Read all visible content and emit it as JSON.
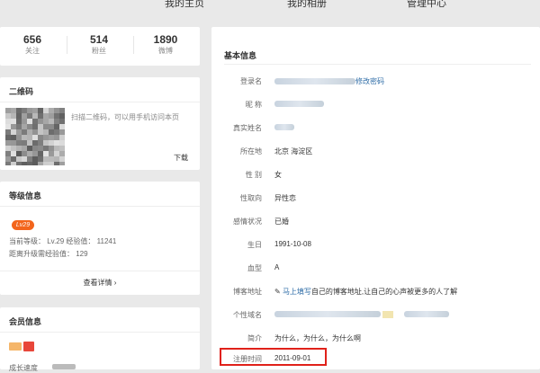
{
  "nav": {
    "tabs": [
      "我的主页",
      "我的相册",
      "管理中心"
    ]
  },
  "stats": [
    {
      "value": "656",
      "label": "关注"
    },
    {
      "value": "514",
      "label": "粉丝"
    },
    {
      "value": "1890",
      "label": "微博"
    }
  ],
  "qr": {
    "title": "二维码",
    "text": "扫描二维码，可以用手机访问本页",
    "download": "下载"
  },
  "level": {
    "title": "等级信息",
    "badge": "Lv29",
    "current": "当前等级：  Lv.29    经验值：  11241",
    "next": "距离升级需经验值：  129",
    "detail": "查看详情 ›"
  },
  "member": {
    "title": "会员信息",
    "streak": "成长速度"
  },
  "basic": {
    "title": "基本信息",
    "change_password": "修改密码",
    "rows": [
      {
        "label": "登录名",
        "value": ""
      },
      {
        "label": "昵 称",
        "value": ""
      },
      {
        "label": "真实姓名",
        "value": ""
      },
      {
        "label": "所在地",
        "value": "北京 海淀区"
      },
      {
        "label": "性 别",
        "value": "女"
      },
      {
        "label": "性取向",
        "value": "异性恋"
      },
      {
        "label": "感情状况",
        "value": "已婚"
      },
      {
        "label": "生日",
        "value": "1991-10-08"
      },
      {
        "label": "血型",
        "value": "A"
      },
      {
        "label": "博客地址",
        "value": "自己的博客地址,让自己的心声被更多的人了解",
        "link": "马上填写"
      },
      {
        "label": "个性域名",
        "value": ""
      },
      {
        "label": "简介",
        "value": "为什么，为什么，为什么啊"
      },
      {
        "label": "注册时间",
        "value": "2011-09-01"
      }
    ]
  },
  "colors": {
    "link": "#2f6da7",
    "highlight": "#e0211a",
    "badge": "#f3651c"
  }
}
